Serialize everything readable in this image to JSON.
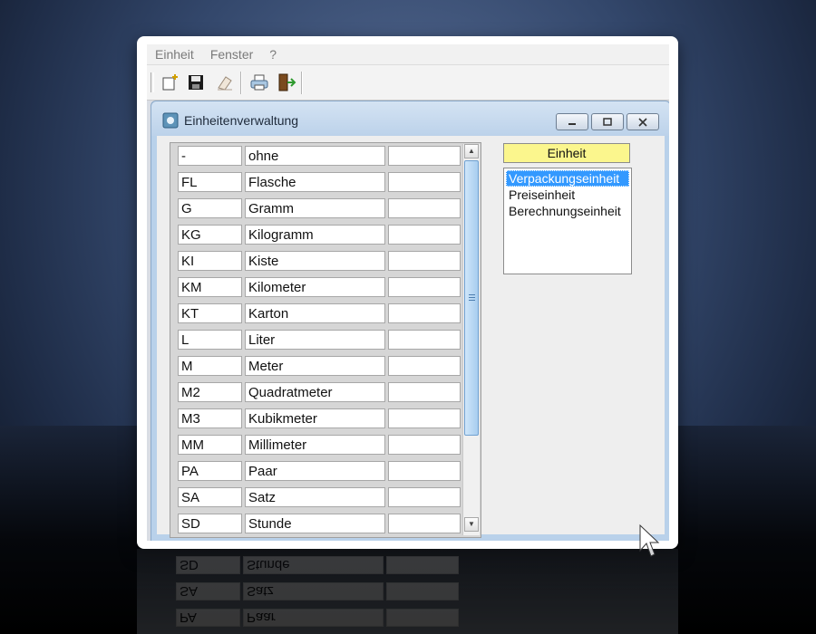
{
  "menubar": {
    "items": [
      "Einheit",
      "Fenster",
      "?"
    ]
  },
  "toolbar": {
    "buttons": [
      "new-icon",
      "save-icon",
      "eraser-icon",
      "print-icon",
      "exit-icon"
    ]
  },
  "window": {
    "title": "Einheitenverwaltung",
    "controls": [
      "minimize-icon",
      "restore-icon",
      "close-icon"
    ]
  },
  "grid": {
    "rows": [
      {
        "code": "-",
        "name": "ohne",
        "extra": ""
      },
      {
        "code": "FL",
        "name": "Flasche",
        "extra": ""
      },
      {
        "code": "G",
        "name": "Gramm",
        "extra": ""
      },
      {
        "code": "KG",
        "name": "Kilogramm",
        "extra": ""
      },
      {
        "code": "KI",
        "name": "Kiste",
        "extra": ""
      },
      {
        "code": "KM",
        "name": "Kilometer",
        "extra": ""
      },
      {
        "code": "KT",
        "name": "Karton",
        "extra": ""
      },
      {
        "code": "L",
        "name": "Liter",
        "extra": ""
      },
      {
        "code": "M",
        "name": "Meter",
        "extra": ""
      },
      {
        "code": "M2",
        "name": "Quadratmeter",
        "extra": ""
      },
      {
        "code": "M3",
        "name": "Kubikmeter",
        "extra": ""
      },
      {
        "code": "MM",
        "name": "Millimeter",
        "extra": ""
      },
      {
        "code": "PA",
        "name": "Paar",
        "extra": ""
      },
      {
        "code": "SA",
        "name": "Satz",
        "extra": ""
      },
      {
        "code": "SD",
        "name": "Stunde",
        "extra": ""
      }
    ]
  },
  "panel": {
    "header": "Einheit",
    "list": [
      "Verpackungseinheit",
      "Preiseinheit",
      "Berechnungseinheit"
    ],
    "selected": "Verpackungseinheit"
  },
  "colors": {
    "header_bg": "#fbf68d",
    "selection": "#3399ff",
    "scrollbar_thumb": "#a8cdef"
  }
}
